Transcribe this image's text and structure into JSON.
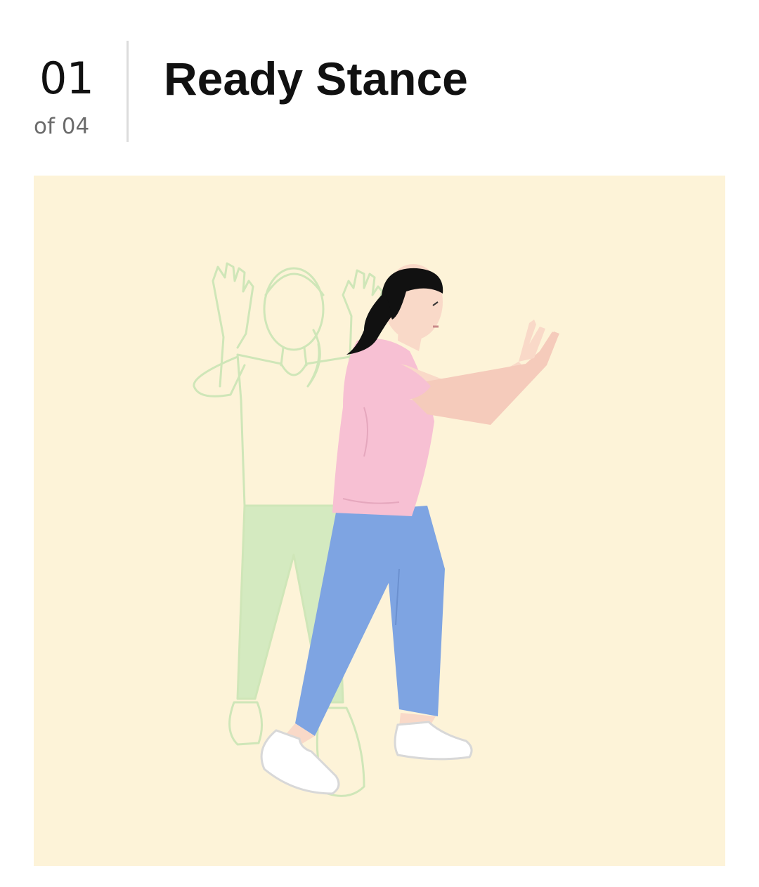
{
  "step": {
    "number": "01",
    "total_label": "of 04",
    "title": "Ready Stance"
  },
  "illustration": {
    "background_color": "#fdf3d8",
    "ghost_color": "#cfe6b8",
    "shirt_color": "#f7c0d3",
    "pants_color": "#7ea4e2",
    "skin_color": "#f9d9c8",
    "hair_color": "#111111",
    "shoe_color": "#ffffff"
  }
}
